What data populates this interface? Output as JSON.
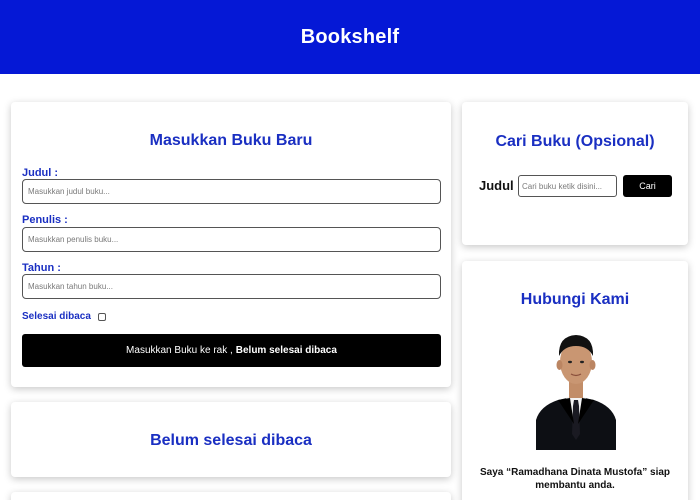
{
  "header": {
    "title": "Bookshelf"
  },
  "input_section": {
    "title": "Masukkan Buku Baru",
    "fields": [
      {
        "label": "Judul :",
        "placeholder": "Masukkan judul buku..."
      },
      {
        "label": "Penulis :",
        "placeholder": "Masukkan penulis buku..."
      },
      {
        "label": "Tahun :",
        "placeholder": "Masukkan tahun buku..."
      }
    ],
    "checkbox_label": "Selesai dibaca",
    "checkbox_checked": false,
    "submit_prefix": "Masukkan Buku ke rak ,",
    "submit_status": "Belum selesai dibaca"
  },
  "unread_section": {
    "title": "Belum selesai dibaca"
  },
  "search_section": {
    "title": "Cari Buku (Opsional)",
    "label": "Judul :",
    "placeholder": "Cari buku ketik disini...",
    "button": "Cari"
  },
  "contact_section": {
    "title": "Hubungi Kami",
    "text": "Saya “Ramadhana Dinata Mustofa” siap membantu anda."
  },
  "colors": {
    "header_bg": "#0518d6",
    "title_blue": "#1a2fc2",
    "button_bg": "#000000"
  },
  "icons": {
    "avatar": "person-photo"
  }
}
